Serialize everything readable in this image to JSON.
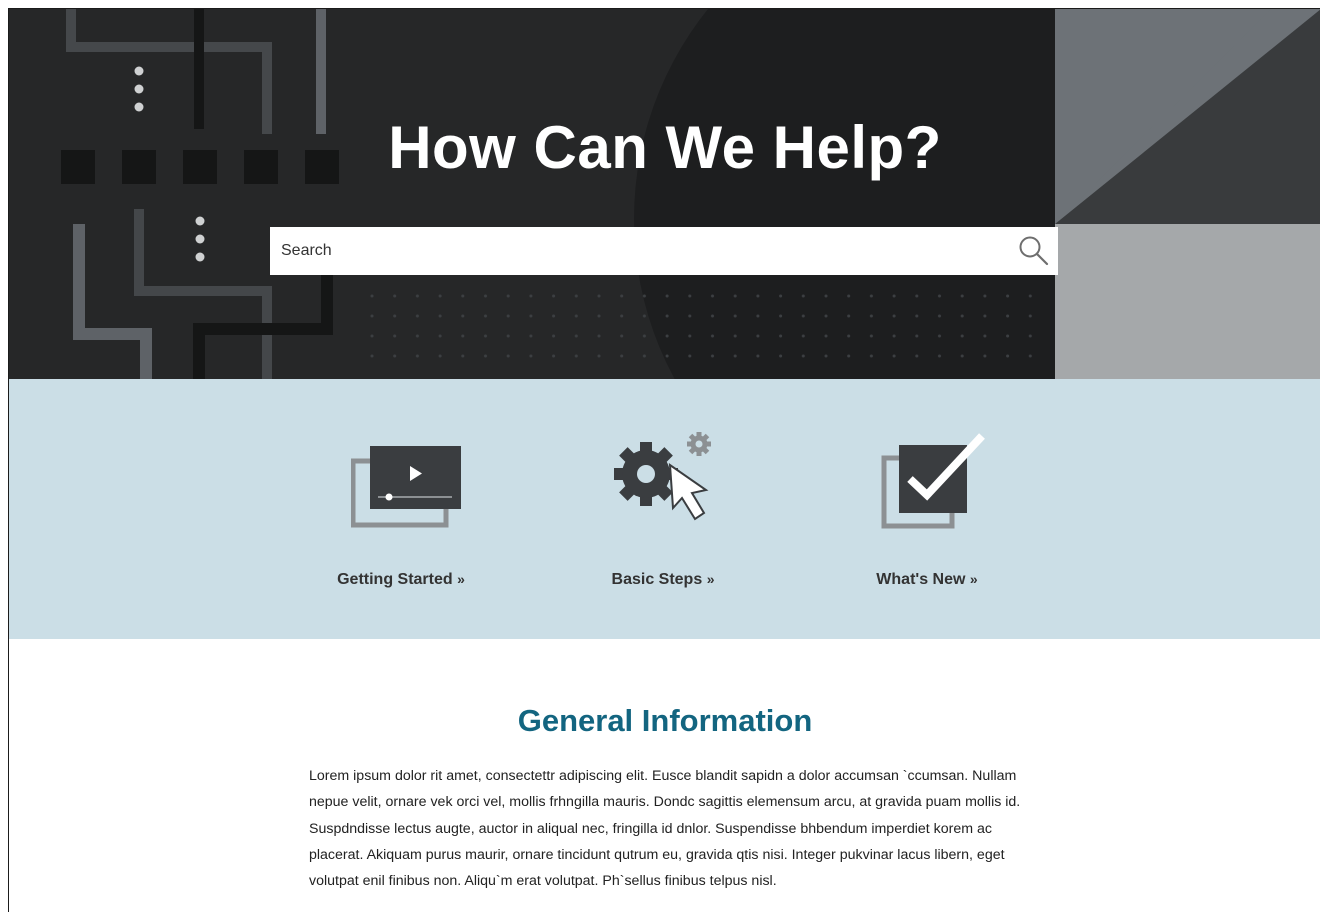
{
  "hero": {
    "title": "How Can We Help?",
    "colors": {
      "background": "#262728",
      "title": "#ffffff"
    }
  },
  "search": {
    "placeholder": "Search",
    "value": "",
    "icon": "magnifier-icon"
  },
  "quick_links": [
    {
      "label": "Getting Started",
      "suffix": "»",
      "icon": "video-player-icon"
    },
    {
      "label": "Basic Steps",
      "suffix": "»",
      "icon": "gear-cursor-icon"
    },
    {
      "label": "What's New",
      "suffix": "»",
      "icon": "checkbox-checked-icon"
    }
  ],
  "quick_links_background": "#cbdee6",
  "general_info": {
    "title": "General Information",
    "title_color": "#136580",
    "body": "Lorem ipsum dolor rit amet, consectettr adipiscing elit. Eusce blandit sapidn a dolor accumsan `ccumsan. Nullam nepue velit, ornare vek orci vel, mollis frhngilla mauris. Dondc sagittis elemensum arcu, at gravida puam mollis id. Suspdndisse lectus augte, auctor in aliqual nec, fringilla id dnlor. Suspendisse bhbendum imperdiet korem ac placerat. Akiquam purus maurir, ornare tincidunt qutrum eu, gravida qtis nisi. Integer pukvinar lacus libern, eget volutpat enil finibus non. Aliqu`m erat volutpat. Ph`sellus finibus telpus nisl."
  }
}
